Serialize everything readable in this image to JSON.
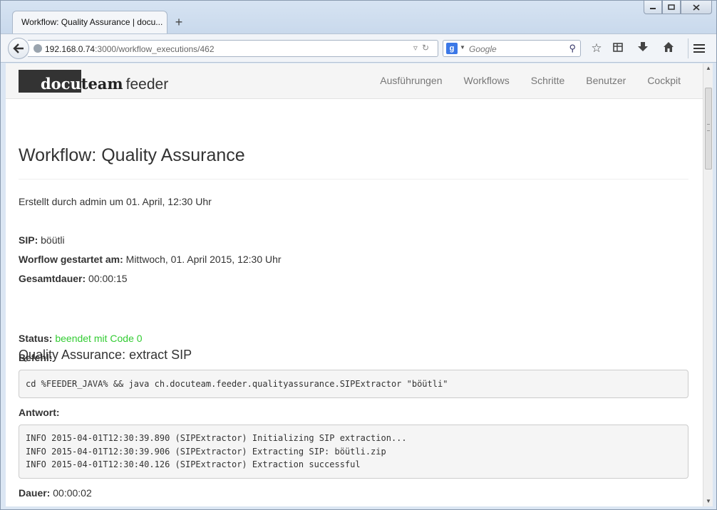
{
  "browser": {
    "tab_title": "Workflow: Quality Assurance | docu...",
    "new_tab": "+",
    "url_host": "192.168.0.74",
    "url_rest": ":3000/workflow_executions/462",
    "search_placeholder": "Google",
    "search_engine": "g"
  },
  "site": {
    "brand_docu": "docu",
    "brand_team": "team",
    "brand_feeder": "feeder",
    "nav": [
      "Ausführungen",
      "Workflows",
      "Schritte",
      "Benutzer",
      "Cockpit"
    ]
  },
  "page": {
    "title": "Workflow: Quality Assurance",
    "created": "Erstellt durch admin um 01. April, 12:30 Uhr",
    "sip_label": "SIP:",
    "sip_value": "böütli",
    "started_label": "Worflow gestartet am:",
    "started_value": "Mittwoch, 01. April 2015, 12:30 Uhr",
    "total_label": "Gesamtdauer:",
    "total_value": "00:00:15",
    "step_title": "Quality Assurance: extract SIP",
    "status_label": "Status:",
    "status_value": "beendet mit Code 0",
    "command_label": "Befehl:",
    "command": "cd %FEEDER_JAVA% && java ch.docuteam.feeder.qualityassurance.SIPExtractor \"böütli\"",
    "response_label": "Antwort:",
    "response": "INFO 2015-04-01T12:30:39.890 (SIPExtractor) Initializing SIP extraction...\nINFO 2015-04-01T12:30:39.906 (SIPExtractor) Extracting SIP: böütli.zip\nINFO 2015-04-01T12:30:40.126 (SIPExtractor) Extraction successful",
    "duration_label": "Dauer:",
    "duration_value": "00:00:02"
  },
  "colors": {
    "status_ok": "#33cc33",
    "brand_block": "#333333"
  }
}
